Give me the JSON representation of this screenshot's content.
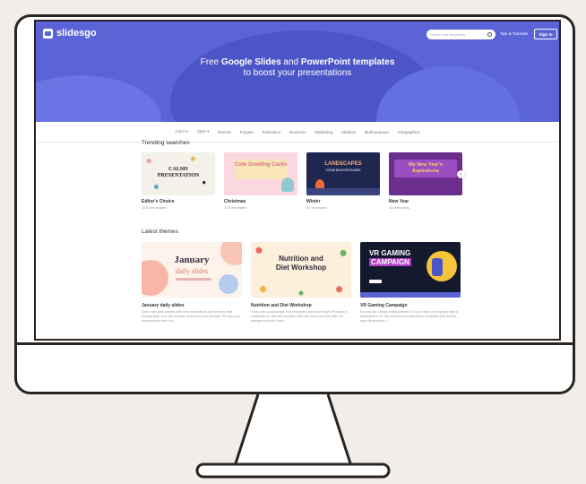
{
  "header": {
    "logo": "slidesgo",
    "search_placeholder": "Search free templates",
    "tips": "Tips & Tutorials",
    "signin": "Sign In",
    "headline_pre": "Free ",
    "headline_b1": "Google Slides",
    "headline_mid": " and ",
    "headline_b2": "PowerPoint templates",
    "headline_line2": "to boost your presentations"
  },
  "nav": [
    "Color ▾",
    "Style ▾",
    "Recent",
    "Popular",
    "Education",
    "Business",
    "Marketing",
    "Medical",
    "Multi-purpose",
    "Infographics"
  ],
  "trending": {
    "title": "Trending searches",
    "cards": [
      {
        "title": "Editor's Choice",
        "sub": "1653 templates",
        "thumb": "CALMS PRESENTATION"
      },
      {
        "title": "Christmas",
        "sub": "273 templates",
        "thumb": "Cute Greeting Cards"
      },
      {
        "title": "Winter",
        "sub": "31 templates",
        "thumb": "LANDSCAPES",
        "thumb2": "ZOOM BACKGROUNDS"
      },
      {
        "title": "New Year",
        "sub": "18 templates",
        "thumb": "My New Year's Aspirations"
      }
    ]
  },
  "latest": {
    "title": "Latest themes",
    "cards": [
      {
        "title": "January daily slides",
        "thumb": "January",
        "thumb2": "daily slides",
        "desc": "Each new year comes with new resolutions and dreams that usually fade over the months. Does it sound familiar? To help you succeed this time arc..."
      },
      {
        "title": "Nutrition and Diet Workshop",
        "thumb": "Nutrition and",
        "thumb2": "Diet Workshop",
        "desc": "If you are a nutritionist, this template comes just right. Prepare a workshop on diet and nutrition with the resources we offer. Its background with food..."
      },
      {
        "title": "VR Gaming Campaign",
        "thumb": "VR GAMING",
        "thumb2": "CAMPAIGN",
        "desc": "Do you like virtual reality games? Do you have a company that is dedicated to it? We present this interactive template with doodle style illustrations. I..."
      }
    ]
  },
  "colors": {
    "brand": "#5a64d7",
    "bezel": "#2a2420",
    "background": "#f1ede8"
  }
}
